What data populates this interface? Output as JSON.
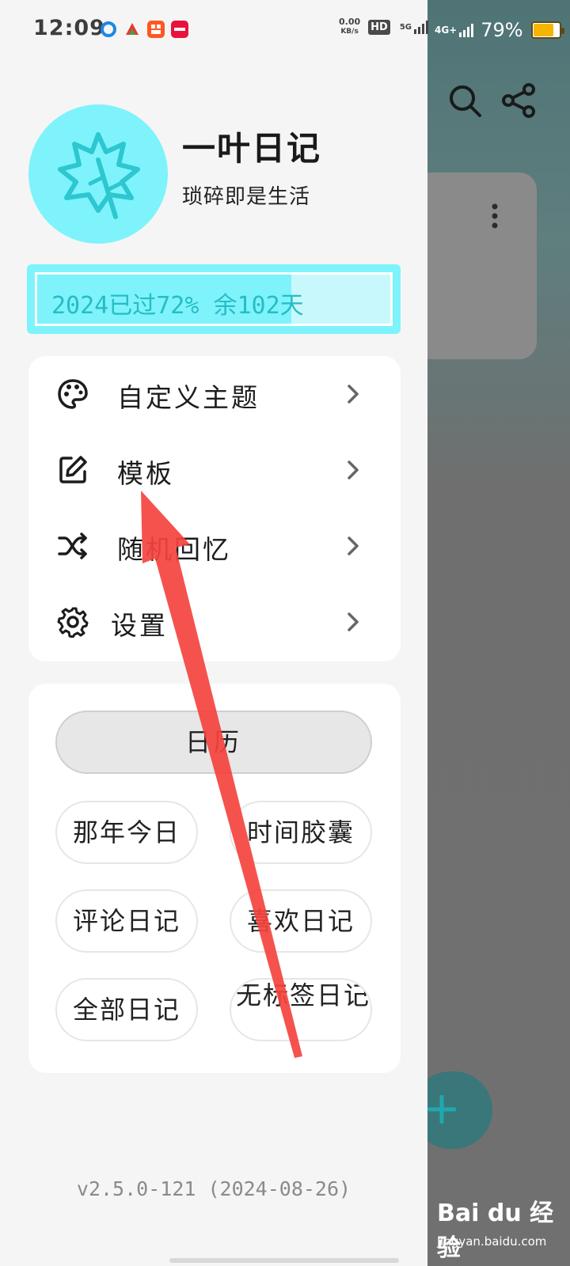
{
  "status_bar": {
    "time": "12:09",
    "net_speed_value": "0.00",
    "net_speed_unit": "KB/s",
    "hd_label": "HD",
    "sim1_label": "5G",
    "sim2_label": "4G+",
    "battery_percent": "79%",
    "battery_level": 0.79
  },
  "profile": {
    "app_name": "一叶日记",
    "slogan": "琐碎即是生活"
  },
  "year_progress": {
    "text": "2024已过72% 余102天",
    "fraction": 0.72
  },
  "menu": [
    {
      "label": "自定义主题",
      "icon": "palette-icon"
    },
    {
      "label": "模板",
      "icon": "edit-icon"
    },
    {
      "label": "随机回忆",
      "icon": "shuffle-icon"
    },
    {
      "label": "设置",
      "icon": "gear-icon"
    }
  ],
  "nav": {
    "calendar_label": "日历",
    "chips": [
      "那年今日",
      "时间胶囊",
      "评论日记",
      "喜欢日记",
      "全部日记",
      "无标签日记"
    ]
  },
  "version": "v2.5.0-121 (2024-08-26)",
  "watermark": {
    "brand": "Bai du 经验",
    "url": "jingyan.baidu.com"
  },
  "colors": {
    "accent": "#7ef3fb",
    "annotation_arrow": "#f4433f"
  }
}
